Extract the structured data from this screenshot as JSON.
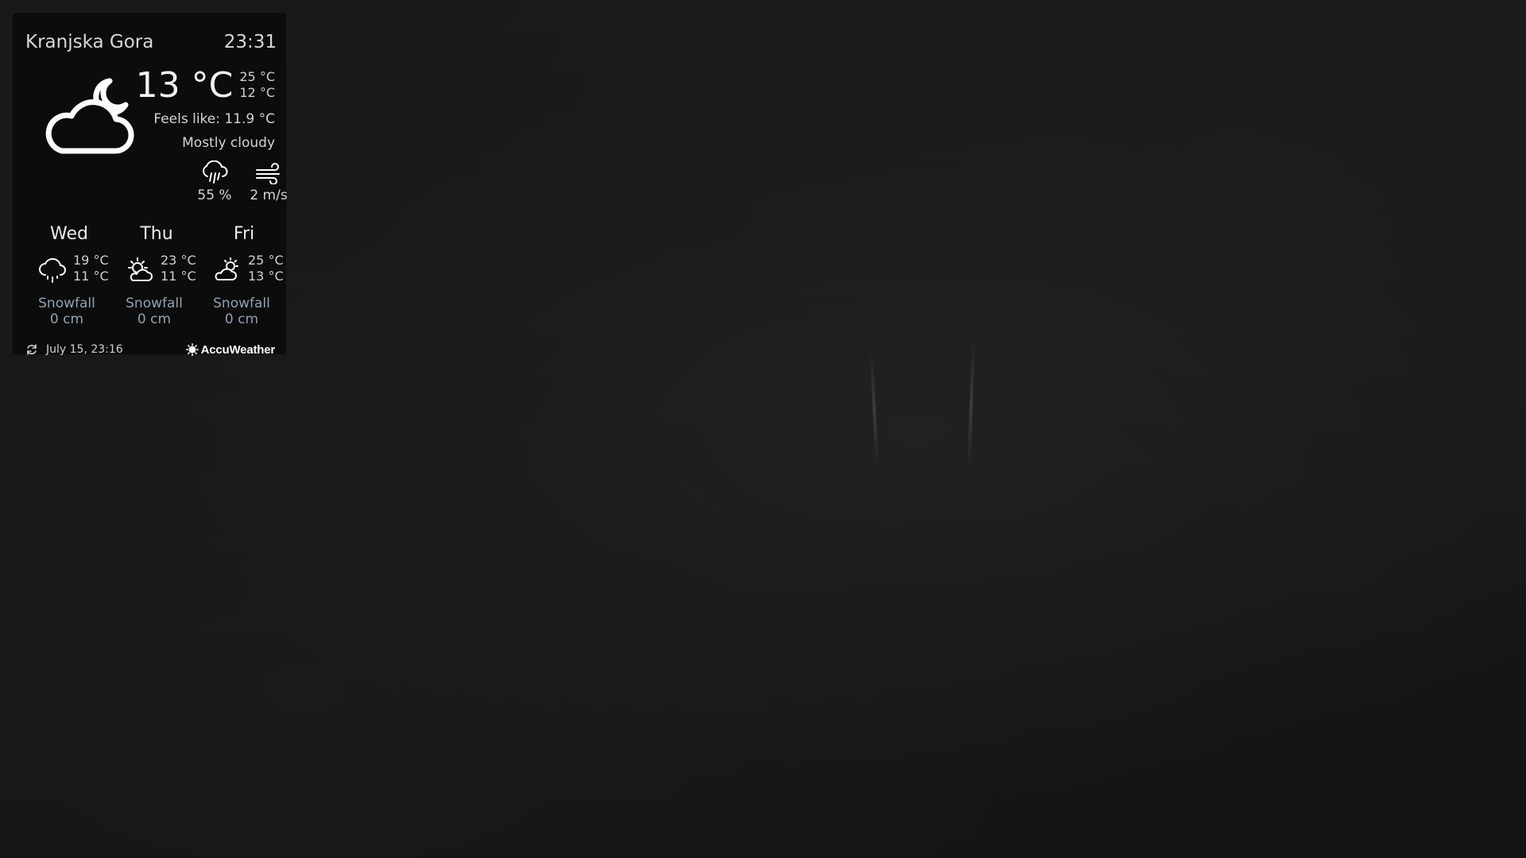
{
  "widget": {
    "location": "Kranjska Gora",
    "time": "23:31"
  },
  "current": {
    "temp": "13 °C",
    "high": "25 °C",
    "low": "12 °C",
    "feels_like": "Feels like: 11.9 °C",
    "condition": "Mostly cloudy",
    "icon": "cloud-moon-icon",
    "precipitation": "55 %",
    "wind": "2 m/s"
  },
  "forecast": [
    {
      "day": "Wed",
      "high": "19 °C",
      "low": "11 °C",
      "icon": "cloud-rain-icon",
      "snow_label": "Snowfall",
      "snow_value": "0 cm"
    },
    {
      "day": "Thu",
      "high": "23 °C",
      "low": "11 °C",
      "icon": "sun-cloud-icon",
      "snow_label": "Snowfall",
      "snow_value": "0 cm"
    },
    {
      "day": "Fri",
      "high": "25 °C",
      "low": "13 °C",
      "icon": "partly-cloudy-icon",
      "snow_label": "Snowfall",
      "snow_value": "0 cm"
    }
  ],
  "footer": {
    "updated": "July 15, 23:16",
    "brand": "AccuWeather"
  },
  "colors": {
    "snow_text": "#8fa3b3",
    "widget_bg": "#0a0a0a"
  }
}
